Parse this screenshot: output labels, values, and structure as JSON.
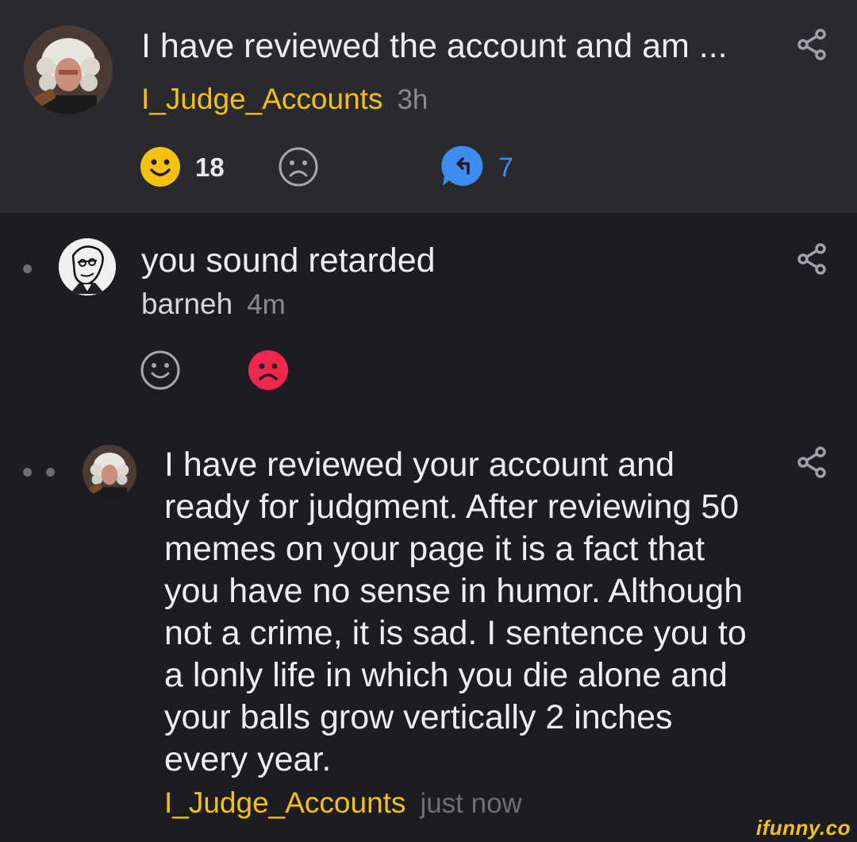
{
  "post": {
    "text": "I have reviewed the account and am ...",
    "user": "I_Judge_Accounts",
    "time": "3h",
    "smile_count": "18",
    "reply_count": "7"
  },
  "comments": [
    {
      "text": "you sound retarded",
      "user": "barneh",
      "time": "4m"
    },
    {
      "text": "I have reviewed your account and ready for judgment. After reviewing 50 memes on your page it is a fact that you have no sense in humor. Although not a crime, it is sad. I sentence you to a lonly life in which you die alone and your balls grow vertically 2 inches every year.",
      "user": "I_Judge_Accounts",
      "time": "just now"
    }
  ],
  "watermark": "ifunny.co",
  "colors": {
    "background": "#1c1c21",
    "top_card": "#29292e",
    "username": "#f4c20d",
    "smile_active": "#f4c20d",
    "frown_active": "#f0264d",
    "reply": "#3d8cf0"
  }
}
